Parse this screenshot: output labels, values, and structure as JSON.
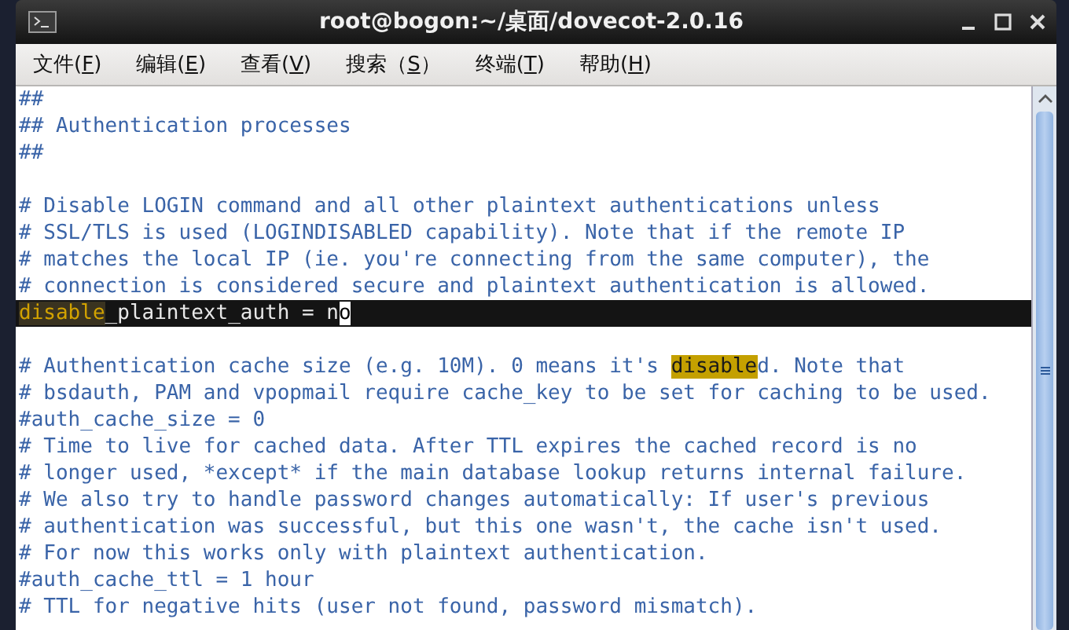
{
  "window": {
    "title": "root@bogon:~/桌面/dovecot-2.0.16"
  },
  "menu": [
    {
      "before": "文件(",
      "key": "F",
      "after": ")"
    },
    {
      "before": "编辑(",
      "key": "E",
      "after": ")"
    },
    {
      "before": "查看(",
      "key": "V",
      "after": ")"
    },
    {
      "before": "搜索（",
      "key": "S",
      "after": "）"
    },
    {
      "before": "终端(",
      "key": "T",
      "after": ")"
    },
    {
      "before": "帮助(",
      "key": "H",
      "after": ")"
    }
  ],
  "editor": {
    "lines": [
      {
        "kind": "text",
        "current": false,
        "segments": [
          {
            "kind": "comment",
            "text": "##"
          }
        ]
      },
      {
        "kind": "text",
        "current": false,
        "segments": [
          {
            "kind": "comment",
            "text": "## Authentication processes"
          }
        ]
      },
      {
        "kind": "text",
        "current": false,
        "segments": [
          {
            "kind": "comment",
            "text": "##"
          }
        ]
      },
      {
        "kind": "blank",
        "current": false
      },
      {
        "kind": "text",
        "current": false,
        "segments": [
          {
            "kind": "comment",
            "text": "# Disable LOGIN command and all other plaintext authentications unless"
          }
        ]
      },
      {
        "kind": "text",
        "current": false,
        "segments": [
          {
            "kind": "comment",
            "text": "# SSL/TLS is used (LOGINDISABLED capability). Note that if the remote IP"
          }
        ]
      },
      {
        "kind": "text",
        "current": false,
        "segments": [
          {
            "kind": "comment",
            "text": "# matches the local IP (ie. you're connecting from the same computer), the"
          }
        ]
      },
      {
        "kind": "text",
        "current": false,
        "segments": [
          {
            "kind": "comment",
            "text": "# connection is considered secure and plaintext authentication is allowed."
          }
        ]
      },
      {
        "kind": "text",
        "current": true,
        "segments": [
          {
            "kind": "match",
            "text": "disable"
          },
          {
            "kind": "code",
            "text": "_plaintext_auth = n"
          },
          {
            "kind": "cursor",
            "text": "o"
          }
        ]
      },
      {
        "kind": "blank",
        "current": false
      },
      {
        "kind": "text",
        "current": false,
        "segments": [
          {
            "kind": "comment",
            "text": "# Authentication cache size (e.g. 10M). 0 means it's "
          },
          {
            "kind": "match",
            "text": "disable"
          },
          {
            "kind": "comment",
            "text": "d. Note that"
          }
        ]
      },
      {
        "kind": "text",
        "current": false,
        "segments": [
          {
            "kind": "comment",
            "text": "# bsdauth, PAM and vpopmail require cache_key to be set for caching to be used."
          }
        ]
      },
      {
        "kind": "text",
        "current": false,
        "segments": [
          {
            "kind": "comment",
            "text": "#auth_cache_size = 0"
          }
        ]
      },
      {
        "kind": "text",
        "current": false,
        "segments": [
          {
            "kind": "comment",
            "text": "# Time to live for cached data. After TTL expires the cached record is no"
          }
        ]
      },
      {
        "kind": "text",
        "current": false,
        "segments": [
          {
            "kind": "comment",
            "text": "# longer used, *except* if the main database lookup returns internal failure."
          }
        ]
      },
      {
        "kind": "text",
        "current": false,
        "segments": [
          {
            "kind": "comment",
            "text": "# We also try to handle password changes automatically: If user's previous"
          }
        ]
      },
      {
        "kind": "text",
        "current": false,
        "segments": [
          {
            "kind": "comment",
            "text": "# authentication was successful, but this one wasn't, the cache isn't used."
          }
        ]
      },
      {
        "kind": "text",
        "current": false,
        "segments": [
          {
            "kind": "comment",
            "text": "# For now this works only with plaintext authentication."
          }
        ]
      },
      {
        "kind": "text",
        "current": false,
        "segments": [
          {
            "kind": "comment",
            "text": "#auth_cache_ttl = 1 hour"
          }
        ]
      },
      {
        "kind": "text",
        "current": false,
        "segments": [
          {
            "kind": "comment",
            "text": "# TTL for negative hits (user not found, password mismatch)."
          }
        ]
      }
    ]
  }
}
